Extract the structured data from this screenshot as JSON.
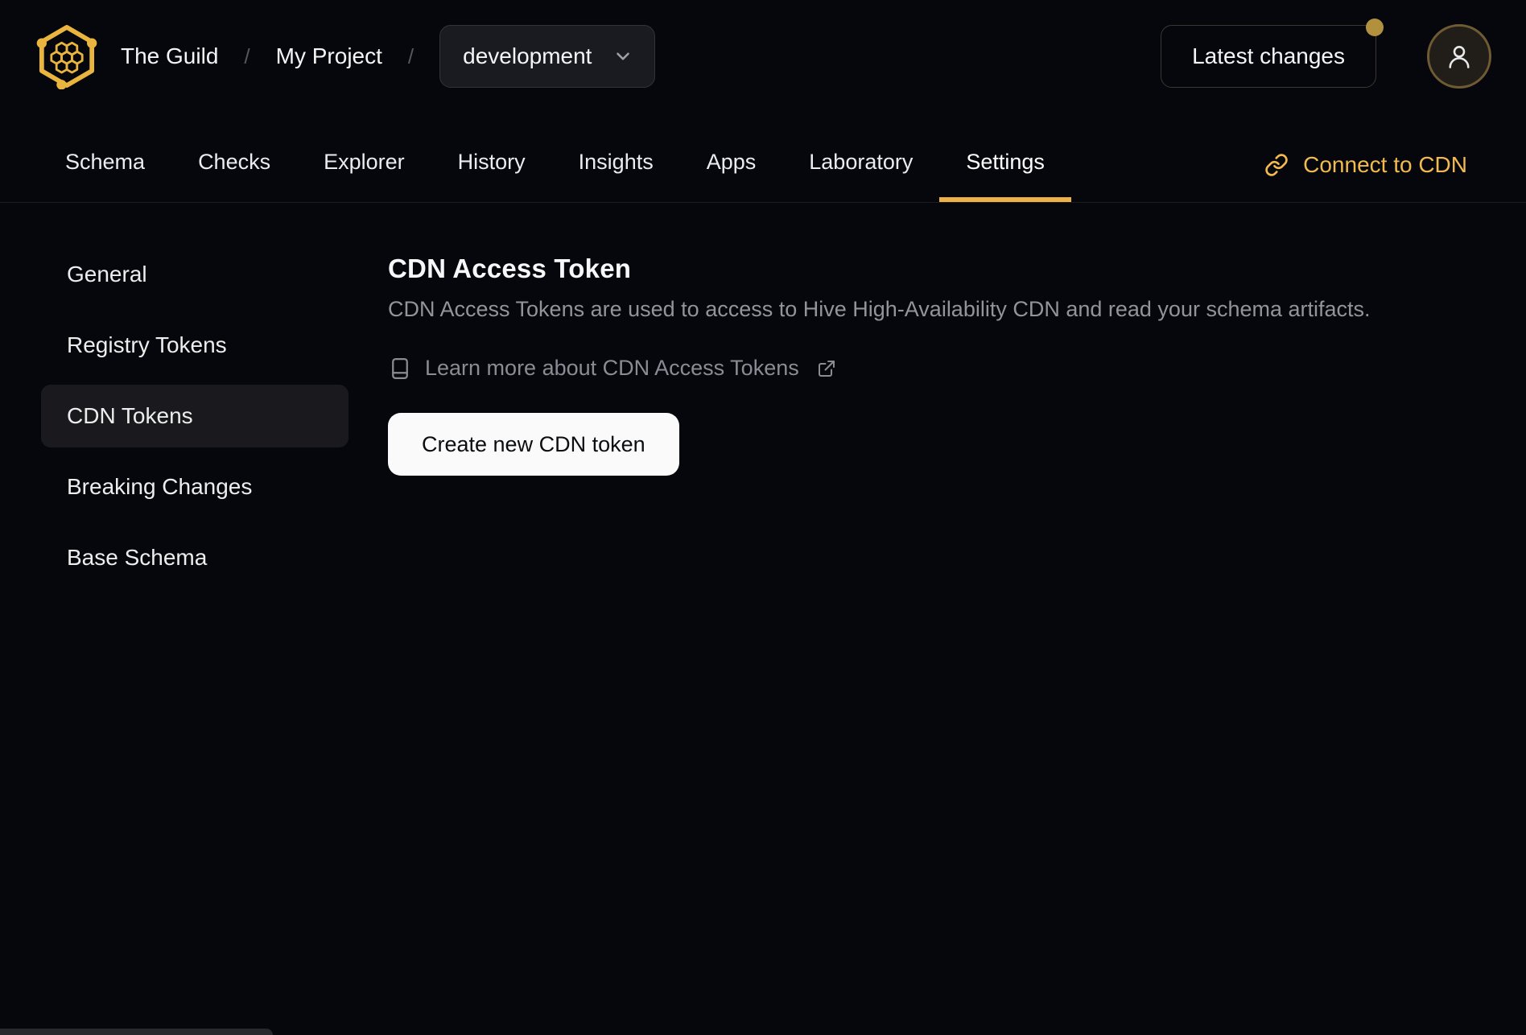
{
  "colors": {
    "background": "#05070d",
    "accent_gold": "#ecb246",
    "link_gold": "#f2ba4f",
    "notification_dot": "#b2913e",
    "muted_text": "#93939b",
    "active_item_bg": "#1a1a1e",
    "primary_button_bg": "#fafafa"
  },
  "header": {
    "logo_icon": "guild-hive-logo",
    "org_name": "The Guild",
    "separator": "/",
    "project_name": "My Project",
    "target_selector": {
      "value": "development",
      "icon": "chevron-down-icon"
    },
    "latest_changes_label": "Latest changes",
    "avatar_icon": "user-icon"
  },
  "tabs": {
    "items": [
      {
        "id": "schema",
        "label": "Schema",
        "active": false
      },
      {
        "id": "checks",
        "label": "Checks",
        "active": false
      },
      {
        "id": "explorer",
        "label": "Explorer",
        "active": false
      },
      {
        "id": "history",
        "label": "History",
        "active": false
      },
      {
        "id": "insights",
        "label": "Insights",
        "active": false
      },
      {
        "id": "apps",
        "label": "Apps",
        "active": false
      },
      {
        "id": "laboratory",
        "label": "Laboratory",
        "active": false
      },
      {
        "id": "settings",
        "label": "Settings",
        "active": true
      }
    ],
    "connect_cdn_label": "Connect to CDN",
    "connect_cdn_icon": "link-icon"
  },
  "sidebar": {
    "items": [
      {
        "id": "general",
        "label": "General",
        "active": false
      },
      {
        "id": "registry-tokens",
        "label": "Registry Tokens",
        "active": false
      },
      {
        "id": "cdn-tokens",
        "label": "CDN Tokens",
        "active": true
      },
      {
        "id": "breaking-changes",
        "label": "Breaking Changes",
        "active": false
      },
      {
        "id": "base-schema",
        "label": "Base Schema",
        "active": false
      }
    ]
  },
  "main": {
    "title": "CDN Access Token",
    "description": "CDN Access Tokens are used to access to Hive High-Availability CDN and read your schema artifacts.",
    "learn_more": {
      "book_icon": "book-icon",
      "label": "Learn more about CDN Access Tokens",
      "external_icon": "external-link-icon"
    },
    "create_button_label": "Create new CDN token"
  }
}
